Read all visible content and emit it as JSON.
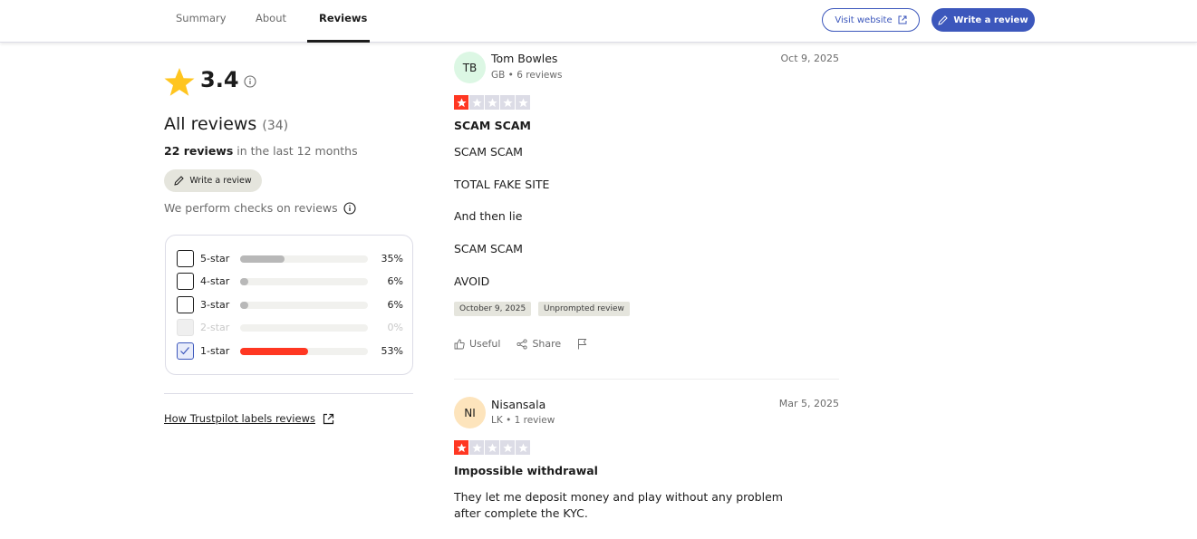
{
  "nav": {
    "tabs": [
      {
        "label": "Summary"
      },
      {
        "label": "About"
      },
      {
        "label": "Reviews"
      }
    ],
    "visit_website": "Visit website",
    "write_review": "Write a review"
  },
  "summary": {
    "rating": "3.4",
    "all_reviews_label": "All reviews",
    "all_reviews_count": "(34)",
    "recent_count": "22 reviews",
    "recent_suffix": " in the last 12 months",
    "write_review": "Write a review",
    "checks_text": "We perform checks on reviews",
    "labels_link": "How Trustpilot labels reviews"
  },
  "filters": [
    {
      "label": "5-star",
      "pct": "35%",
      "fraction": 0.35,
      "state": "unchecked",
      "color": "#b8b8b8"
    },
    {
      "label": "4-star",
      "pct": "6%",
      "fraction": 0.06,
      "state": "unchecked",
      "color": "#b8b8b8"
    },
    {
      "label": "3-star",
      "pct": "6%",
      "fraction": 0.06,
      "state": "unchecked",
      "color": "#b8b8b8"
    },
    {
      "label": "2-star",
      "pct": "0%",
      "fraction": 0.0,
      "state": "disabled",
      "color": "#b8b8b8"
    },
    {
      "label": "1-star",
      "pct": "53%",
      "fraction": 0.53,
      "state": "checked",
      "color": "#ff3722"
    }
  ],
  "reviews": [
    {
      "initials": "TB",
      "avatar_color": "#dcf7e4",
      "name": "Tom Bowles",
      "meta": "GB • 6 reviews",
      "date": "Oct 9, 2025",
      "stars": 1,
      "title": "SCAM SCAM",
      "lines": [
        "SCAM SCAM",
        "TOTAL FAKE SITE",
        "And then lie",
        "SCAM SCAM",
        "AVOID"
      ],
      "tags": [
        "October 9, 2025",
        "Unprompted review"
      ],
      "actions": {
        "useful": "Useful",
        "share": "Share"
      }
    },
    {
      "initials": "NI",
      "avatar_color": "#fde4bc",
      "name": "Nisansala",
      "meta": "LK • 1 review",
      "date": "Mar 5, 2025",
      "stars": 1,
      "title": "Impossible withdrawal",
      "body": "They let me deposit money and play without any problem after complete the KYC."
    }
  ],
  "colors": {
    "brand_blue": "#3c57bc",
    "star_red": "#ff3722",
    "star_empty": "#dcdce6",
    "rating_star": "#ffc51f"
  },
  "icons": {
    "rating": "star-icon",
    "info": "info-icon",
    "external": "external-link-icon",
    "pencil": "pencil-icon",
    "thumb": "thumbs-up-icon",
    "share": "share-icon",
    "flag": "flag-icon"
  }
}
